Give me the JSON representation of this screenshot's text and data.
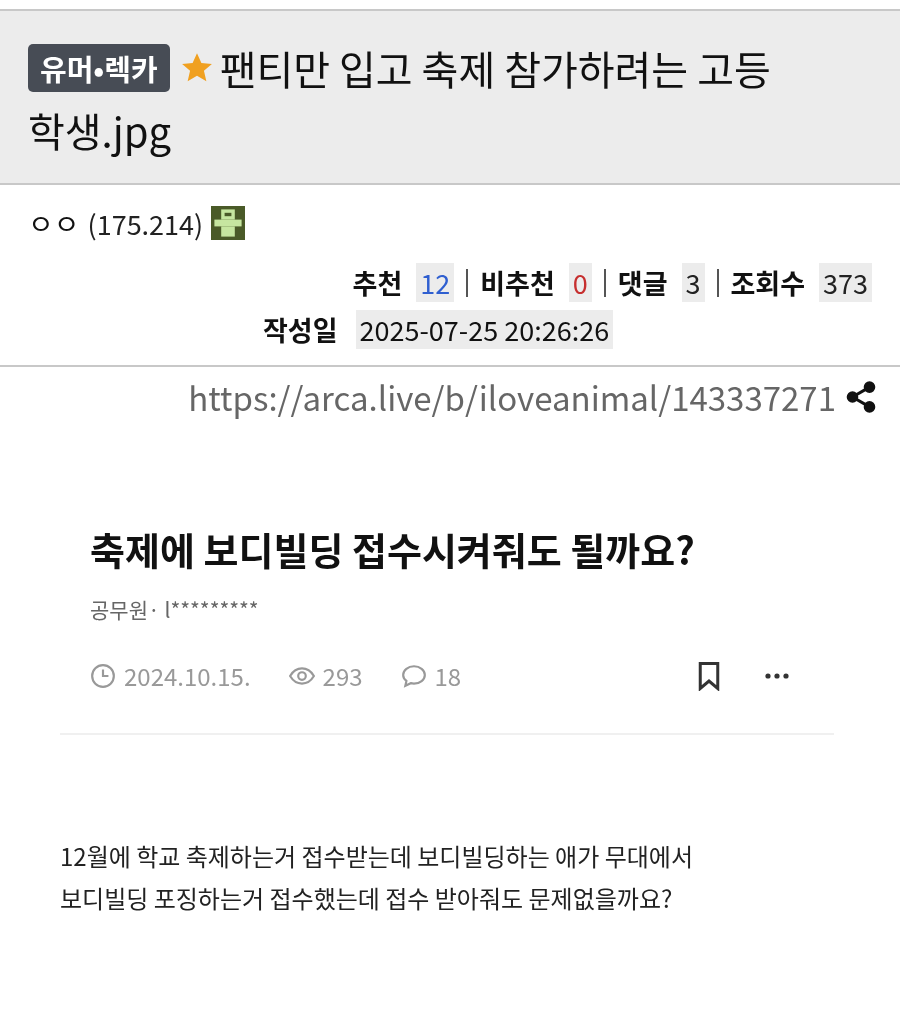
{
  "post": {
    "category": "유머•렉카",
    "starred": true,
    "title_lines": [
      "팬티만 입고 축제 참가하려는 고등",
      "학생.jpg"
    ],
    "author": "ㅇㅇ",
    "ip": "(175.214)",
    "stats": [
      {
        "label": "추천",
        "value": "12",
        "kind": "up"
      },
      {
        "label": "비추천",
        "value": "0",
        "kind": "down"
      },
      {
        "label": "댓글",
        "value": "3",
        "kind": "plain"
      },
      {
        "label": "조회수",
        "value": "373",
        "kind": "plain"
      }
    ],
    "date_label": "작성일",
    "date": "2025-07-25 20:26:26",
    "url": "https://arca.live/b/iloveanimal/143337271"
  },
  "embedded": {
    "title": "축제에 보디빌딩 접수시켜줘도 될까요?",
    "author": "공무원· l*********",
    "date": "2024.10.15.",
    "views": "293",
    "comments": "18",
    "body": [
      "12월에 학교 축제하는거 접수받는데 보디빌딩하는 애가 무대에서",
      "보디빌딩 포징하는거 접수했는데 접수 받아줘도 문제없을까요?"
    ]
  }
}
